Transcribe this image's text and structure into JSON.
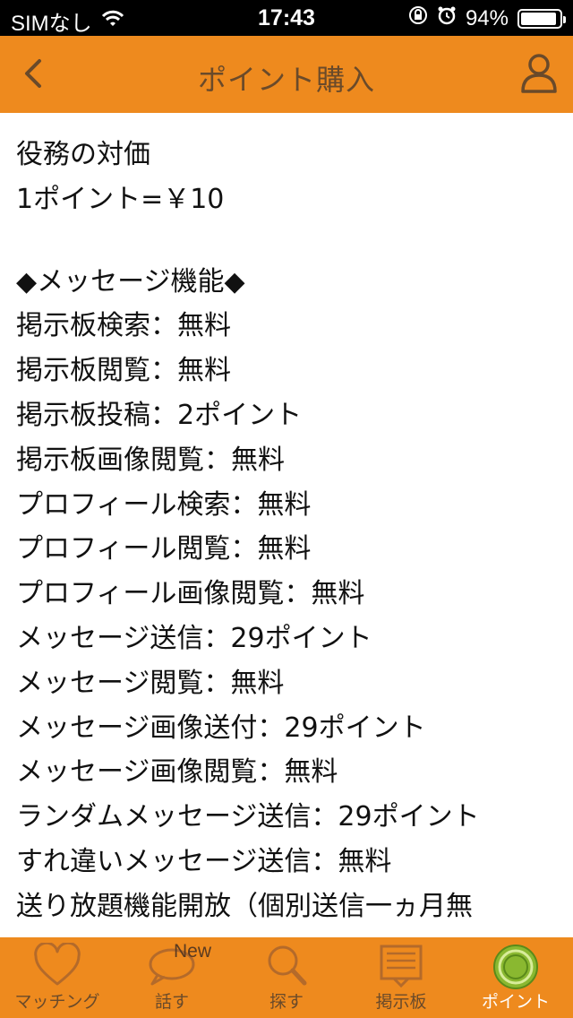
{
  "status_bar": {
    "carrier": "SIMなし",
    "time": "17:43",
    "battery_percent_text": "94%",
    "battery_level": 0.94
  },
  "nav": {
    "title": "ポイント購入",
    "back_icon": "chevron-left-icon",
    "profile_icon": "user-icon"
  },
  "content": {
    "lines_top": [
      "役務の対価",
      "1ポイント=￥10"
    ],
    "lines": [
      "◆メッセージ機能◆",
      "掲示板検索：無料",
      "掲示板閲覧：無料",
      "掲示板投稿：2ポイント",
      "掲示板画像閲覧：無料",
      "プロフィール検索：無料",
      "プロフィール閲覧：無料",
      "プロフィール画像閲覧：無料",
      "メッセージ送信：29ポイント",
      "メッセージ閲覧：無料",
      "メッセージ画像送付：29ポイント",
      "メッセージ画像閲覧：無料",
      "ランダムメッセージ送信：29ポイント",
      "すれ違いメッセージ送信：無料",
      "送り放題機能開放（個別送信一ヵ月無"
    ]
  },
  "tabs": [
    {
      "label": "マッチング",
      "icon": "heart-icon"
    },
    {
      "label": "話す",
      "icon": "speech-bubble-icon",
      "badge": "New"
    },
    {
      "label": "探す",
      "icon": "search-icon"
    },
    {
      "label": "掲示板",
      "icon": "board-icon"
    },
    {
      "label": "ポイント",
      "icon": "coin-icon"
    }
  ],
  "colors": {
    "accent": "#ee8a1e",
    "nav_text": "#6a4a2a",
    "active_icon": "#7ab02a"
  }
}
